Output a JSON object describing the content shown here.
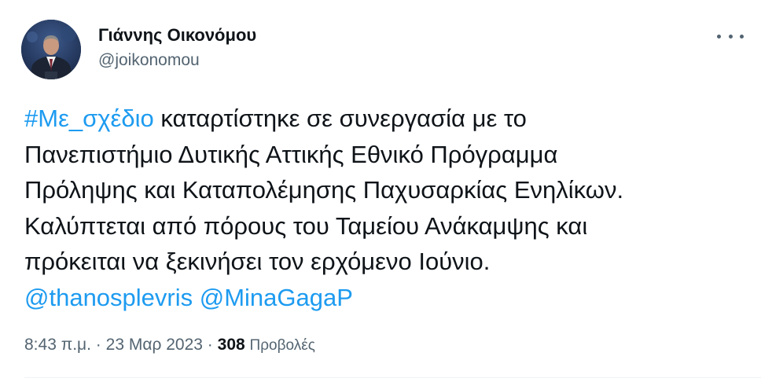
{
  "author": {
    "name": "Γιάννης Οικονόμου",
    "handle": "@joikonomou"
  },
  "tweet": {
    "hashtag": "#Με_σχέδιο",
    "line1_rest": " καταρτίστηκε σε συνεργασία με το",
    "line2": "Πανεπιστήμιο Δυτικής Αττικής Εθνικό Πρόγραμμα",
    "line3": "Πρόληψης και Καταπολέμησης Παχυσαρκίας Ενηλίκων.",
    "line4": "Καλύπτεται από πόρους του Ταμείου Ανάκαμψης και",
    "line5": "πρόκειται να ξεκινήσει τον ερχόμενο Ιούνιο.",
    "mention1": "@thanosplevris",
    "mention2": "@MinaGagaP"
  },
  "meta": {
    "time": "8:43 π.μ.",
    "separator": " · ",
    "date": "23 Μαρ 2023",
    "views_count": "308",
    "views_label": "Προβολές"
  },
  "colors": {
    "link": "#1d9bf0",
    "secondary_text": "#536471",
    "primary_text": "#0f1419"
  },
  "icons": {
    "more": "more-horizontal-icon"
  }
}
